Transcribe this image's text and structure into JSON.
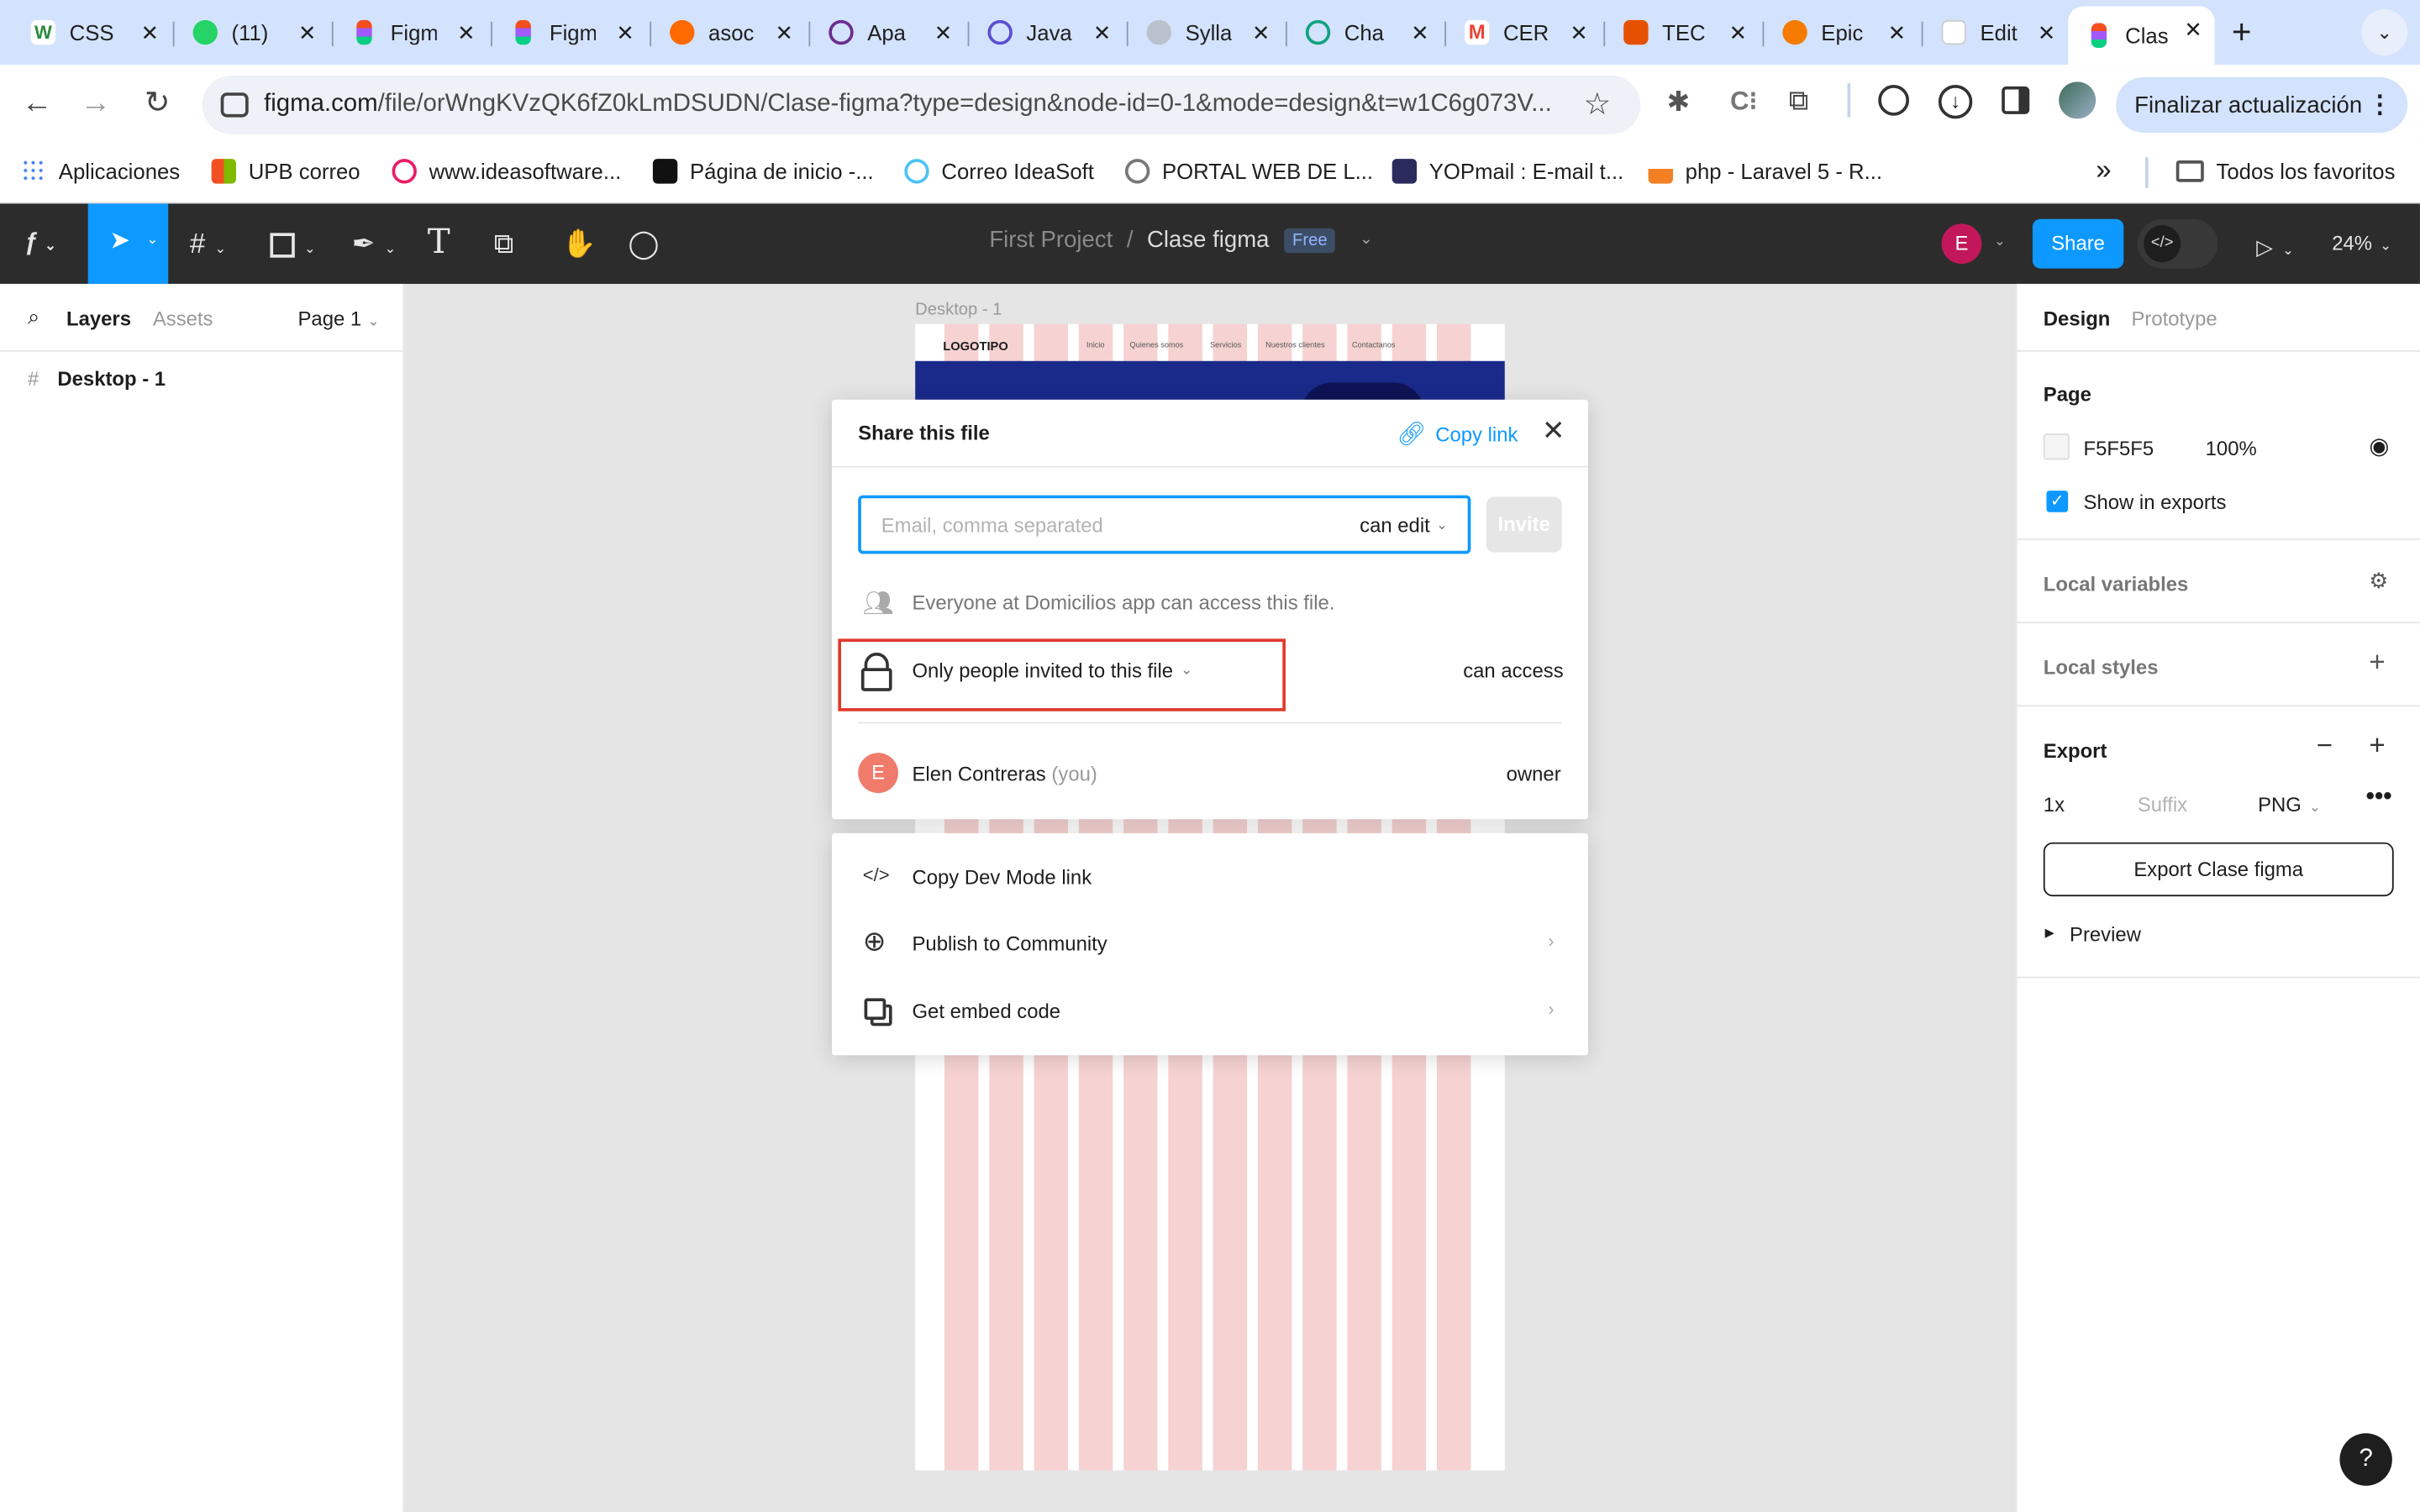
{
  "browser": {
    "tabs": [
      {
        "label": "CSS",
        "color": "#2c8a3e"
      },
      {
        "label": "(11)",
        "color": "#25d366"
      },
      {
        "label": "Figm",
        "color": "#f24e1e"
      },
      {
        "label": "Figm",
        "color": "#f24e1e"
      },
      {
        "label": "asoc",
        "color": "#ff6a00"
      },
      {
        "label": "Apa",
        "color": "#6b2d8f"
      },
      {
        "label": "Java",
        "color": "#5a4fcf"
      },
      {
        "label": "Sylla",
        "color": "#9aa5b1"
      },
      {
        "label": "Cha",
        "color": "#10a37f"
      },
      {
        "label": "CER",
        "color": "#ea4335"
      },
      {
        "label": "TEC",
        "color": "#e65100"
      },
      {
        "label": "Epic",
        "color": "#f57c00"
      },
      {
        "label": "Edit",
        "color": "#ffffff"
      },
      {
        "label": "Clas",
        "color": "#f24e1e"
      }
    ],
    "url_host": "figma.com",
    "url_path": "/file/orWngKVzQK6fZ0kLmDSUDN/Clase-figma?type=design&node-id=0-1&mode=design&t=w1C6g073V...",
    "update_button": "Finalizar actualización",
    "bookmarks": [
      {
        "label": "Aplicaciones",
        "color": "#4285f4"
      },
      {
        "label": "UPB correo",
        "color": "#f25022"
      },
      {
        "label": "www.ideasoftware...",
        "color": "#e91e63"
      },
      {
        "label": "Página de inicio -...",
        "color": "#111111"
      },
      {
        "label": "Correo IdeaSoft",
        "color": "#4fc3f7"
      },
      {
        "label": "PORTAL WEB DE L...",
        "color": "#777777"
      },
      {
        "label": "YOPmail : E-mail t...",
        "color": "#2b2b5e"
      },
      {
        "label": "php - Laravel 5 - R...",
        "color": "#f48024"
      }
    ],
    "all_bookmarks": "Todos los favoritos"
  },
  "figma": {
    "project": "First Project",
    "separator": "/",
    "file_name": "Clase figma",
    "plan_badge": "Free",
    "avatar_initial": "E",
    "share_button": "Share",
    "zoom": "24%",
    "left_tabs": {
      "layers": "Layers",
      "assets": "Assets",
      "page": "Page 1"
    },
    "layer_item": "Desktop - 1",
    "canvas": {
      "frame_label": "Desktop - 1",
      "logo_text": "LOGOTIPO",
      "nav_links": [
        "Inicio",
        "Quienes somos",
        "Servicios",
        "Nuestros clientes",
        "Contactanos"
      ]
    },
    "right_panel": {
      "tabs": {
        "design": "Design",
        "prototype": "Prototype"
      },
      "page_section": "Page",
      "page_color": "F5F5F5",
      "page_opacity": "100%",
      "show_in_exports": "Show in exports",
      "local_variables": "Local variables",
      "local_styles": "Local styles",
      "export": "Export",
      "export_scale": "1x",
      "export_suffix_placeholder": "Suffix",
      "export_format": "PNG",
      "export_button": "Export Clase figma",
      "preview": "Preview"
    },
    "help": "?"
  },
  "share_dialog": {
    "title": "Share this file",
    "copy_link": "Copy link",
    "email_placeholder": "Email, comma separated",
    "permission": "can edit",
    "invite_button": "Invite",
    "org_access": "Everyone at Domicilios app can access this file.",
    "access_scope": "Only people invited to this file",
    "access_level": "can access",
    "member_initial": "E",
    "member_name": "Elen Contreras",
    "member_you": "(you)",
    "member_role": "owner",
    "highlight_color": "#e03a2b"
  },
  "more_dialog": {
    "items": [
      {
        "label": "Copy Dev Mode link"
      },
      {
        "label": "Publish to Community"
      },
      {
        "label": "Get embed code"
      }
    ]
  },
  "colors": {
    "accent": "#0d99ff",
    "figma_bar": "#2c2c2c",
    "avatar": "#c2185b",
    "member_avatar": "#f07b6b"
  }
}
